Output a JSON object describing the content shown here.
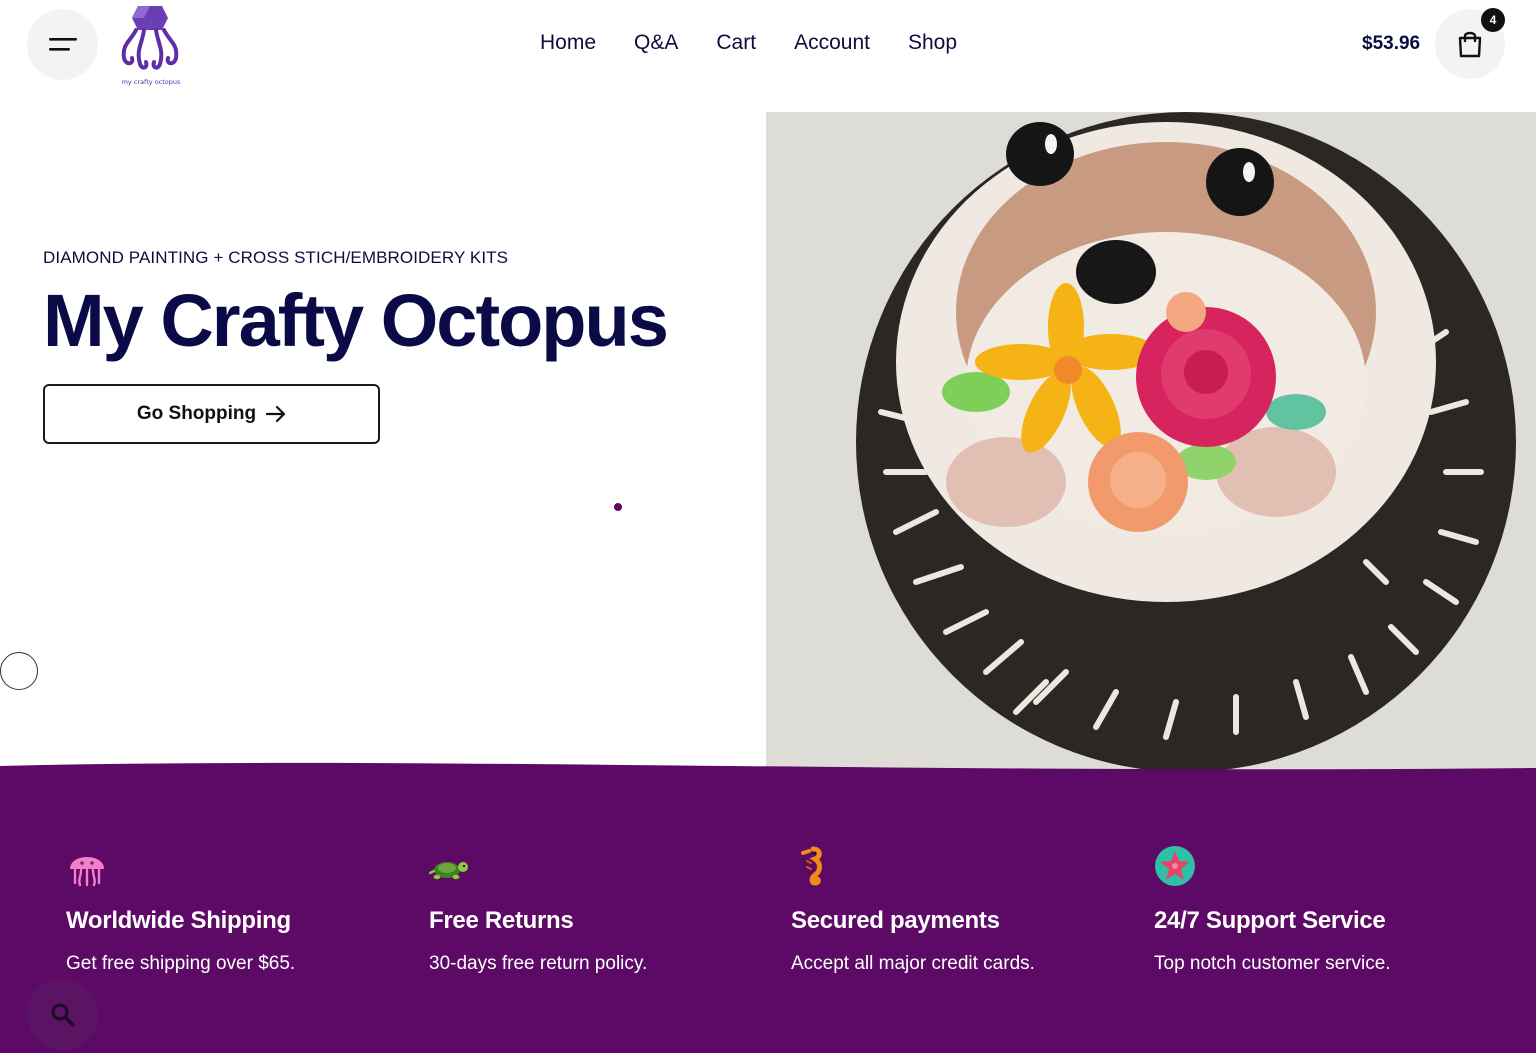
{
  "header": {
    "nav": [
      {
        "label": "Home"
      },
      {
        "label": "Q&A"
      },
      {
        "label": "Cart"
      },
      {
        "label": "Account"
      },
      {
        "label": "Shop"
      }
    ],
    "cart_total": "$53.96",
    "cart_count": "4",
    "logo_text": "my crafty octopus"
  },
  "hero": {
    "eyebrow": "DIAMOND PAINTING + CROSS STICH/EMBROIDERY KITS",
    "title": "My Crafty Octopus",
    "cta_label": "Go Shopping"
  },
  "features": [
    {
      "icon": "jellyfish-icon",
      "title": "Worldwide Shipping",
      "text": "Get free shipping over $65."
    },
    {
      "icon": "turtle-icon",
      "title": "Free Returns",
      "text": "30-days free return policy."
    },
    {
      "icon": "seahorse-icon",
      "title": "Secured payments",
      "text": "Accept all major credit cards."
    },
    {
      "icon": "starfish-icon",
      "title": "24/7 Support Service",
      "text": "Top notch customer service."
    }
  ],
  "colors": {
    "brand_purple": "#5c0a66",
    "navy": "#0a0b46",
    "button_bg": "#f3f3f3"
  }
}
